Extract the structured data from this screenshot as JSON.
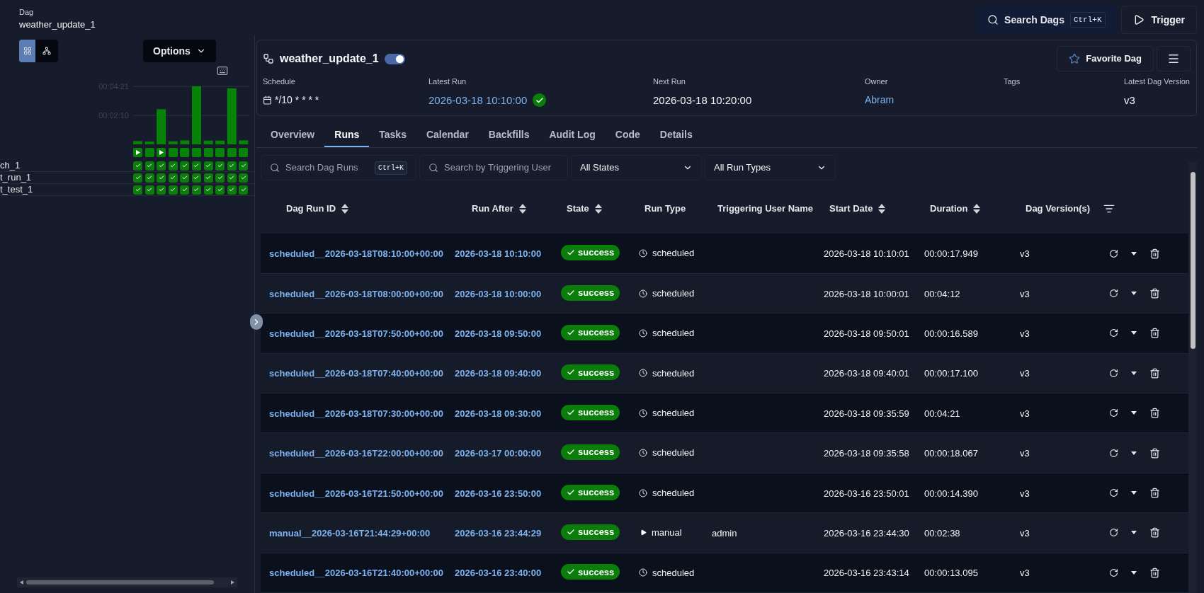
{
  "header": {
    "label": "Dag",
    "dag_name": "weather_update_1",
    "search": {
      "label": "Search Dags",
      "shortcut": "Ctrl+K"
    },
    "trigger": "Trigger"
  },
  "grid_panel": {
    "view_toggle": [
      {
        "kind": "grid",
        "selected": true
      },
      {
        "kind": "graph",
        "selected": false
      }
    ],
    "options": "Options",
    "chart_data": {
      "type": "bar",
      "values": [
        15,
        13,
        158,
        14,
        18,
        261,
        17,
        17,
        252,
        18
      ],
      "ylim": [
        0,
        261
      ],
      "yticks": [
        {
          "value": 130,
          "label": "00:02:10"
        },
        {
          "value": 261,
          "label": "00:04:21"
        }
      ]
    },
    "run_markers": [
      {
        "kind": "manual"
      },
      {
        "kind": "scheduled"
      },
      {
        "kind": "manual"
      },
      {
        "kind": "scheduled"
      },
      {
        "kind": "scheduled"
      },
      {
        "kind": "scheduled"
      },
      {
        "kind": "scheduled"
      },
      {
        "kind": "scheduled"
      },
      {
        "kind": "scheduled"
      },
      {
        "kind": "scheduled"
      }
    ],
    "tasks": [
      {
        "name": "ch_1",
        "cells": [
          {
            "kind": "success"
          },
          {
            "kind": "success"
          },
          {
            "kind": "success"
          },
          {
            "kind": "success"
          },
          {
            "kind": "success"
          },
          {
            "kind": "success"
          },
          {
            "kind": "success"
          },
          {
            "kind": "success"
          },
          {
            "kind": "success"
          },
          {
            "kind": "success"
          }
        ]
      },
      {
        "name": "t_run_1",
        "cells": [
          {
            "kind": "success"
          },
          {
            "kind": "success"
          },
          {
            "kind": "success"
          },
          {
            "kind": "success"
          },
          {
            "kind": "success"
          },
          {
            "kind": "success"
          },
          {
            "kind": "success"
          },
          {
            "kind": "success"
          },
          {
            "kind": "success"
          },
          {
            "kind": "success"
          }
        ]
      },
      {
        "name": "t_test_1",
        "cells": [
          {
            "kind": "success"
          },
          {
            "kind": "success"
          },
          {
            "kind": "success"
          },
          {
            "kind": "success"
          },
          {
            "kind": "success"
          },
          {
            "kind": "success"
          },
          {
            "kind": "success"
          },
          {
            "kind": "success"
          },
          {
            "kind": "success"
          },
          {
            "kind": "success"
          }
        ]
      }
    ]
  },
  "dag_card": {
    "title": "weather_update_1",
    "enabled": true,
    "favorite": "Favorite Dag",
    "fields": [
      {
        "label": "Schedule",
        "value": "*/10 * * * *",
        "kind": "schedule"
      },
      {
        "label": "Latest Run",
        "value": "2026-03-18 10:10:00",
        "kind": "latest_run",
        "succeeded": true
      },
      {
        "label": "Next Run",
        "value": "2026-03-18 10:20:00",
        "kind": "plain"
      },
      {
        "label": "Owner",
        "value": "Abram",
        "kind": "link"
      },
      {
        "label": "Tags",
        "kind": "plain"
      },
      {
        "label": "Latest Dag Version",
        "value": "v3",
        "kind": "plain"
      }
    ]
  },
  "tabs": [
    {
      "label": "Overview",
      "selected": false
    },
    {
      "label": "Runs",
      "selected": true
    },
    {
      "label": "Tasks",
      "selected": false
    },
    {
      "label": "Calendar",
      "selected": false
    },
    {
      "label": "Backfills",
      "selected": false
    },
    {
      "label": "Audit Log",
      "selected": false
    },
    {
      "label": "Code",
      "selected": false
    },
    {
      "label": "Details",
      "selected": false
    }
  ],
  "filters": {
    "search_runs": {
      "placeholder": "Search Dag Runs",
      "shortcut": "Ctrl+K"
    },
    "search_user": {
      "placeholder": "Search by Triggering User"
    },
    "state_select": "All States",
    "type_select": "All Run Types"
  },
  "table": {
    "columns": [
      {
        "label": "Dag Run ID",
        "sortable": true
      },
      {
        "label": "Run After",
        "sortable": true
      },
      {
        "label": "State",
        "sortable": true
      },
      {
        "label": "Run Type",
        "sortable": false
      },
      {
        "label": "Triggering User Name",
        "sortable": false
      },
      {
        "label": "Start Date",
        "sortable": true
      },
      {
        "label": "Duration",
        "sortable": true
      },
      {
        "label": "Dag Version(s)",
        "sortable": false
      }
    ],
    "rows": [
      {
        "id": "scheduled__2026-03-18T08:10:00+00:00",
        "run_after": "2026-03-18 10:10:00",
        "state": "success",
        "run_type": "scheduled",
        "user": "",
        "start": "2026-03-18 10:10:01",
        "duration": "00:00:17.949",
        "version": "v3"
      },
      {
        "id": "scheduled__2026-03-18T08:00:00+00:00",
        "run_after": "2026-03-18 10:00:00",
        "state": "success",
        "run_type": "scheduled",
        "user": "",
        "start": "2026-03-18 10:00:01",
        "duration": "00:04:12",
        "version": "v3"
      },
      {
        "id": "scheduled__2026-03-18T07:50:00+00:00",
        "run_after": "2026-03-18 09:50:00",
        "state": "success",
        "run_type": "scheduled",
        "user": "",
        "start": "2026-03-18 09:50:01",
        "duration": "00:00:16.589",
        "version": "v3"
      },
      {
        "id": "scheduled__2026-03-18T07:40:00+00:00",
        "run_after": "2026-03-18 09:40:00",
        "state": "success",
        "run_type": "scheduled",
        "user": "",
        "start": "2026-03-18 09:40:01",
        "duration": "00:00:17.100",
        "version": "v3"
      },
      {
        "id": "scheduled__2026-03-18T07:30:00+00:00",
        "run_after": "2026-03-18 09:30:00",
        "state": "success",
        "run_type": "scheduled",
        "user": "",
        "start": "2026-03-18 09:35:59",
        "duration": "00:04:21",
        "version": "v3"
      },
      {
        "id": "scheduled__2026-03-16T22:00:00+00:00",
        "run_after": "2026-03-17 00:00:00",
        "state": "success",
        "run_type": "scheduled",
        "user": "",
        "start": "2026-03-18 09:35:58",
        "duration": "00:00:18.067",
        "version": "v3"
      },
      {
        "id": "scheduled__2026-03-16T21:50:00+00:00",
        "run_after": "2026-03-16 23:50:00",
        "state": "success",
        "run_type": "scheduled",
        "user": "",
        "start": "2026-03-16 23:50:01",
        "duration": "00:00:14.390",
        "version": "v3"
      },
      {
        "id": "manual__2026-03-16T21:44:29+00:00",
        "run_after": "2026-03-16 23:44:29",
        "state": "success",
        "run_type": "manual",
        "user": "admin",
        "start": "2026-03-16 23:44:30",
        "duration": "00:02:38",
        "version": "v3"
      },
      {
        "id": "scheduled__2026-03-16T21:40:00+00:00",
        "run_after": "2026-03-16 23:40:00",
        "state": "success",
        "run_type": "scheduled",
        "user": "",
        "start": "2026-03-16 23:43:14",
        "duration": "00:00:13.095",
        "version": "v3"
      }
    ]
  }
}
